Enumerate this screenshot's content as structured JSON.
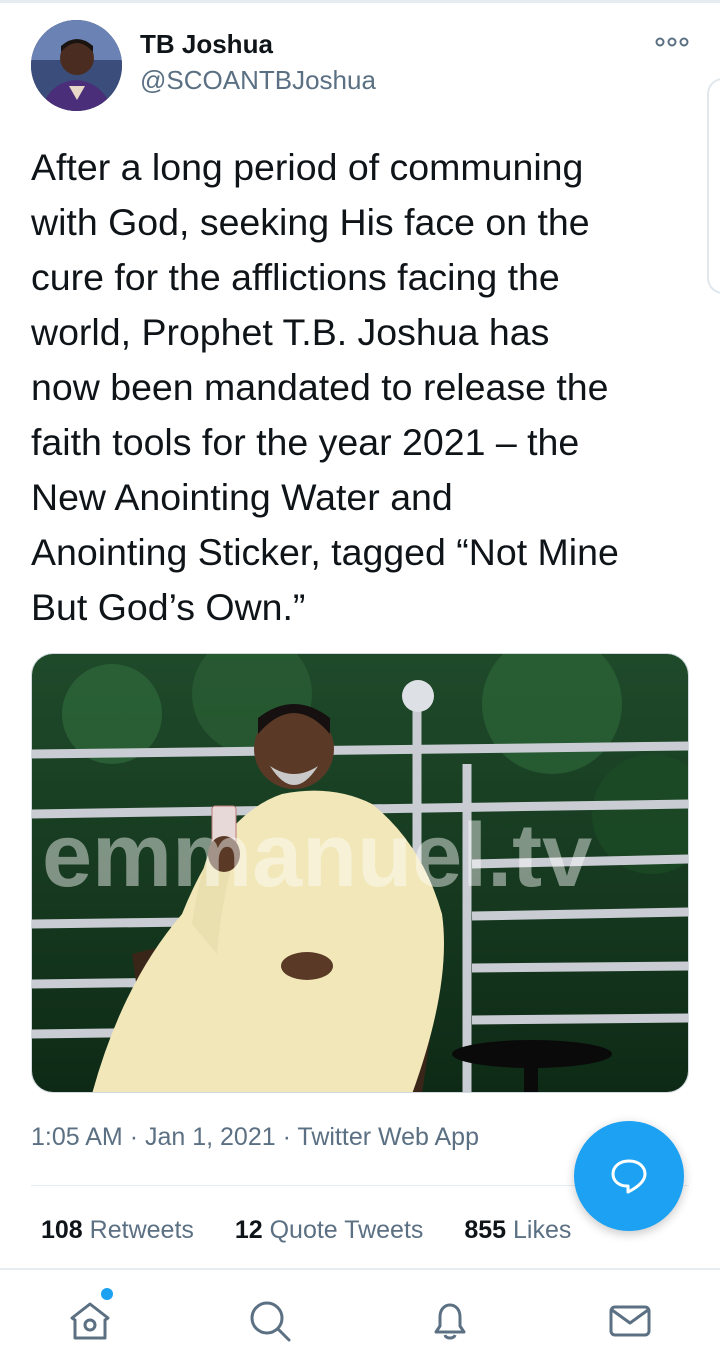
{
  "user": {
    "name": "TB Joshua",
    "handle": "@SCOANTBJoshua"
  },
  "tweet": {
    "text": "After a long period of communing\nwith God, seeking His face on the\ncure for the afflictions facing the\nworld, Prophet T.B. Joshua has\nnow been mandated to release the\nfaith tools for the year 2021 – the\nNew Anointing Water and\nAnointing Sticker, tagged “Not Mine\nBut God’s Own.”",
    "media_watermark": "emmanuel.tv",
    "time": "1:05 AM",
    "date": "Jan 1, 2021",
    "source": "Twitter Web App",
    "separator": "·"
  },
  "stats": [
    {
      "count": "108",
      "label": "Retweets"
    },
    {
      "count": "12",
      "label": "Quote Tweets"
    },
    {
      "count": "855",
      "label": "Likes"
    }
  ],
  "icons": {
    "more": "more-horizontal-icon",
    "fab": "reply-bubble-icon",
    "nav": [
      "home-icon",
      "search-icon",
      "notifications-bell-icon",
      "messages-envelope-icon"
    ]
  },
  "colors": {
    "accent": "#1da1f2",
    "text": "#0f1419",
    "secondary": "#5b7083"
  }
}
